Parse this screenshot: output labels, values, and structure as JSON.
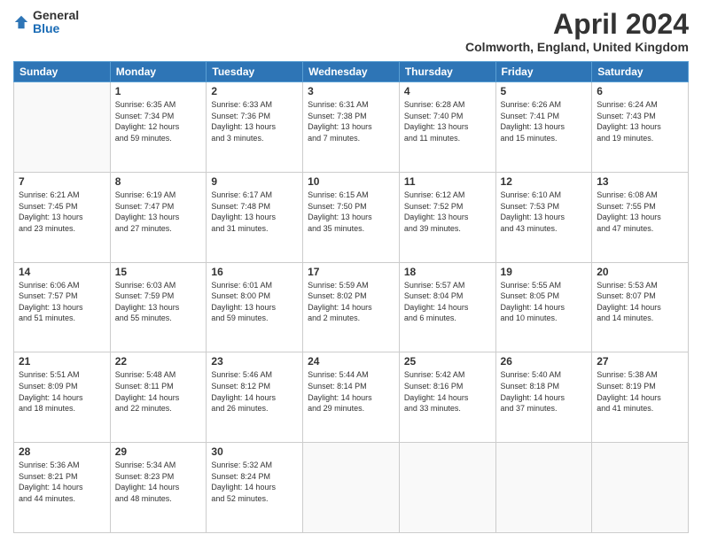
{
  "header": {
    "logo": {
      "general": "General",
      "blue": "Blue"
    },
    "title": "April 2024",
    "location": "Colmworth, England, United Kingdom"
  },
  "days_of_week": [
    "Sunday",
    "Monday",
    "Tuesday",
    "Wednesday",
    "Thursday",
    "Friday",
    "Saturday"
  ],
  "weeks": [
    [
      {
        "day": "",
        "info": ""
      },
      {
        "day": "1",
        "info": "Sunrise: 6:35 AM\nSunset: 7:34 PM\nDaylight: 12 hours\nand 59 minutes."
      },
      {
        "day": "2",
        "info": "Sunrise: 6:33 AM\nSunset: 7:36 PM\nDaylight: 13 hours\nand 3 minutes."
      },
      {
        "day": "3",
        "info": "Sunrise: 6:31 AM\nSunset: 7:38 PM\nDaylight: 13 hours\nand 7 minutes."
      },
      {
        "day": "4",
        "info": "Sunrise: 6:28 AM\nSunset: 7:40 PM\nDaylight: 13 hours\nand 11 minutes."
      },
      {
        "day": "5",
        "info": "Sunrise: 6:26 AM\nSunset: 7:41 PM\nDaylight: 13 hours\nand 15 minutes."
      },
      {
        "day": "6",
        "info": "Sunrise: 6:24 AM\nSunset: 7:43 PM\nDaylight: 13 hours\nand 19 minutes."
      }
    ],
    [
      {
        "day": "7",
        "info": "Sunrise: 6:21 AM\nSunset: 7:45 PM\nDaylight: 13 hours\nand 23 minutes."
      },
      {
        "day": "8",
        "info": "Sunrise: 6:19 AM\nSunset: 7:47 PM\nDaylight: 13 hours\nand 27 minutes."
      },
      {
        "day": "9",
        "info": "Sunrise: 6:17 AM\nSunset: 7:48 PM\nDaylight: 13 hours\nand 31 minutes."
      },
      {
        "day": "10",
        "info": "Sunrise: 6:15 AM\nSunset: 7:50 PM\nDaylight: 13 hours\nand 35 minutes."
      },
      {
        "day": "11",
        "info": "Sunrise: 6:12 AM\nSunset: 7:52 PM\nDaylight: 13 hours\nand 39 minutes."
      },
      {
        "day": "12",
        "info": "Sunrise: 6:10 AM\nSunset: 7:53 PM\nDaylight: 13 hours\nand 43 minutes."
      },
      {
        "day": "13",
        "info": "Sunrise: 6:08 AM\nSunset: 7:55 PM\nDaylight: 13 hours\nand 47 minutes."
      }
    ],
    [
      {
        "day": "14",
        "info": "Sunrise: 6:06 AM\nSunset: 7:57 PM\nDaylight: 13 hours\nand 51 minutes."
      },
      {
        "day": "15",
        "info": "Sunrise: 6:03 AM\nSunset: 7:59 PM\nDaylight: 13 hours\nand 55 minutes."
      },
      {
        "day": "16",
        "info": "Sunrise: 6:01 AM\nSunset: 8:00 PM\nDaylight: 13 hours\nand 59 minutes."
      },
      {
        "day": "17",
        "info": "Sunrise: 5:59 AM\nSunset: 8:02 PM\nDaylight: 14 hours\nand 2 minutes."
      },
      {
        "day": "18",
        "info": "Sunrise: 5:57 AM\nSunset: 8:04 PM\nDaylight: 14 hours\nand 6 minutes."
      },
      {
        "day": "19",
        "info": "Sunrise: 5:55 AM\nSunset: 8:05 PM\nDaylight: 14 hours\nand 10 minutes."
      },
      {
        "day": "20",
        "info": "Sunrise: 5:53 AM\nSunset: 8:07 PM\nDaylight: 14 hours\nand 14 minutes."
      }
    ],
    [
      {
        "day": "21",
        "info": "Sunrise: 5:51 AM\nSunset: 8:09 PM\nDaylight: 14 hours\nand 18 minutes."
      },
      {
        "day": "22",
        "info": "Sunrise: 5:48 AM\nSunset: 8:11 PM\nDaylight: 14 hours\nand 22 minutes."
      },
      {
        "day": "23",
        "info": "Sunrise: 5:46 AM\nSunset: 8:12 PM\nDaylight: 14 hours\nand 26 minutes."
      },
      {
        "day": "24",
        "info": "Sunrise: 5:44 AM\nSunset: 8:14 PM\nDaylight: 14 hours\nand 29 minutes."
      },
      {
        "day": "25",
        "info": "Sunrise: 5:42 AM\nSunset: 8:16 PM\nDaylight: 14 hours\nand 33 minutes."
      },
      {
        "day": "26",
        "info": "Sunrise: 5:40 AM\nSunset: 8:18 PM\nDaylight: 14 hours\nand 37 minutes."
      },
      {
        "day": "27",
        "info": "Sunrise: 5:38 AM\nSunset: 8:19 PM\nDaylight: 14 hours\nand 41 minutes."
      }
    ],
    [
      {
        "day": "28",
        "info": "Sunrise: 5:36 AM\nSunset: 8:21 PM\nDaylight: 14 hours\nand 44 minutes."
      },
      {
        "day": "29",
        "info": "Sunrise: 5:34 AM\nSunset: 8:23 PM\nDaylight: 14 hours\nand 48 minutes."
      },
      {
        "day": "30",
        "info": "Sunrise: 5:32 AM\nSunset: 8:24 PM\nDaylight: 14 hours\nand 52 minutes."
      },
      {
        "day": "",
        "info": ""
      },
      {
        "day": "",
        "info": ""
      },
      {
        "day": "",
        "info": ""
      },
      {
        "day": "",
        "info": ""
      }
    ]
  ]
}
